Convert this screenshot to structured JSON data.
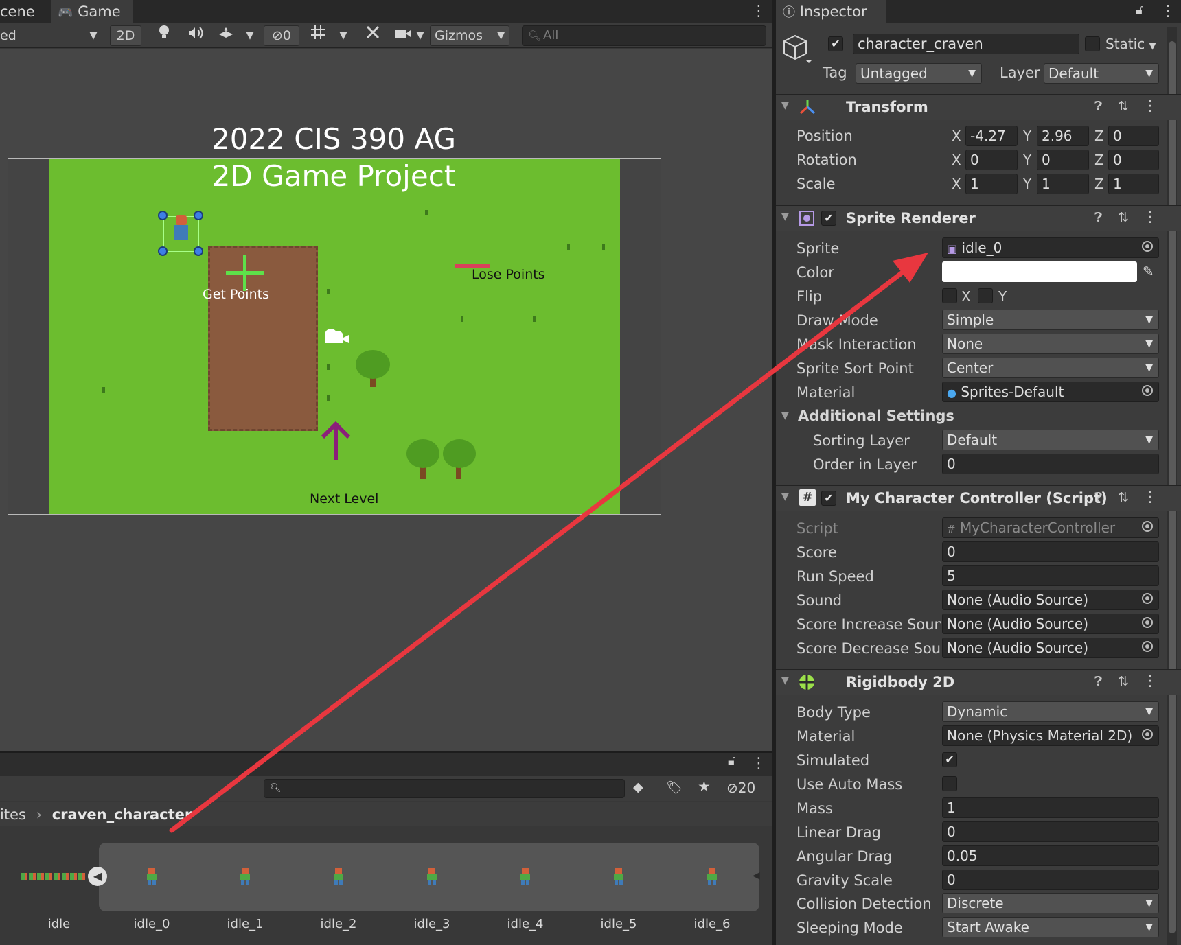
{
  "scene_tabs": {
    "scene_label": "cene",
    "game_label": "Game"
  },
  "toolbar": {
    "draw_mode": "ed",
    "two_d": "2D",
    "hidden_count": "0",
    "gizmos": "Gizmos",
    "search_placeholder": "All"
  },
  "game_scene": {
    "title_line1": "2022 CIS 390 AG",
    "title_line2": "2D Game Project",
    "get_points": "Get Points",
    "lose_points": "Lose Points",
    "next_level": "Next Level"
  },
  "project": {
    "hidden_count": "20",
    "breadcrumb_parent": "ites",
    "breadcrumb_current": "craven_character",
    "sprites": [
      "idle",
      "idle_0",
      "idle_1",
      "idle_2",
      "idle_3",
      "idle_4",
      "idle_5",
      "idle_6"
    ]
  },
  "inspector": {
    "tab_label": "Inspector",
    "object_name": "character_craven",
    "static_label": "Static",
    "tag_label": "Tag",
    "tag_value": "Untagged",
    "layer_label": "Layer",
    "layer_value": "Default",
    "transform": {
      "title": "Transform",
      "position_label": "Position",
      "rotation_label": "Rotation",
      "scale_label": "Scale",
      "axis_x": "X",
      "axis_y": "Y",
      "axis_z": "Z",
      "position": [
        "-4.27",
        "2.96",
        "0"
      ],
      "rotation": [
        "0",
        "0",
        "0"
      ],
      "scale": [
        "1",
        "1",
        "1"
      ]
    },
    "sprite_renderer": {
      "title": "Sprite Renderer",
      "sprite_label": "Sprite",
      "sprite_value": "idle_0",
      "color_label": "Color",
      "color_value": "#ffffff",
      "flip_label": "Flip",
      "flip_x": "X",
      "flip_y": "Y",
      "draw_mode_label": "Draw Mode",
      "draw_mode_value": "Simple",
      "mask_label": "Mask Interaction",
      "mask_value": "None",
      "sort_point_label": "Sprite Sort Point",
      "sort_point_value": "Center",
      "material_label": "Material",
      "material_value": "Sprites-Default",
      "additional_label": "Additional Settings",
      "sorting_layer_label": "Sorting Layer",
      "sorting_layer_value": "Default",
      "order_label": "Order in Layer",
      "order_value": "0"
    },
    "controller": {
      "title": "My Character Controller (Script)",
      "script_label": "Script",
      "script_value": "MyCharacterController",
      "score_label": "Score",
      "score_value": "0",
      "run_speed_label": "Run Speed",
      "run_speed_value": "5",
      "sound_label": "Sound",
      "sound_value": "None (Audio Source)",
      "score_inc_label": "Score Increase Sounc",
      "score_inc_value": "None (Audio Source)",
      "score_dec_label": "Score Decrease Soun",
      "score_dec_value": "None (Audio Source)"
    },
    "rigidbody": {
      "title": "Rigidbody 2D",
      "body_type_label": "Body Type",
      "body_type_value": "Dynamic",
      "material_label": "Material",
      "material_value": "None (Physics Material 2D)",
      "simulated_label": "Simulated",
      "simulated": true,
      "auto_mass_label": "Use Auto Mass",
      "auto_mass": false,
      "mass_label": "Mass",
      "mass_value": "1",
      "linear_drag_label": "Linear Drag",
      "linear_drag_value": "0",
      "angular_drag_label": "Angular Drag",
      "angular_drag_value": "0.05",
      "gravity_label": "Gravity Scale",
      "gravity_value": "0",
      "collision_label": "Collision Detection",
      "collision_value": "Discrete",
      "sleeping_label": "Sleeping Mode",
      "sleeping_value": "Start Awake"
    }
  },
  "colors": {
    "annotation_arrow": "#e8373f",
    "grass": "#6cbd2f",
    "dirt": "#8a5a3e"
  }
}
